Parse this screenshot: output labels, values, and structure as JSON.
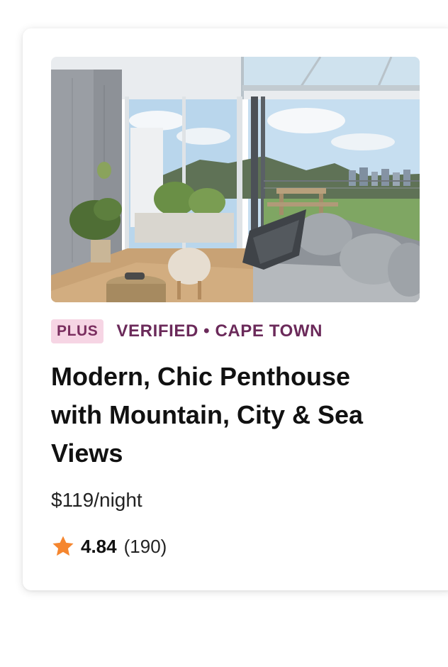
{
  "listing": {
    "photo_alt": "Penthouse living room with sliding glass doors opening to a terrace with city and mountain views",
    "badge": "PLUS",
    "verified_location": "VERIFIED • CAPE TOWN",
    "title": "Modern, Chic Penthouse with Mountain, City & Sea Views",
    "price": "$119/night",
    "rating": "4.84",
    "review_count": "(190)"
  },
  "colors": {
    "badge_bg": "#f6d5e4",
    "badge_text": "#7a2e5f",
    "verified_text": "#6b2a5a",
    "star": "#f5862f"
  },
  "icons": {
    "rating": "star-icon"
  }
}
